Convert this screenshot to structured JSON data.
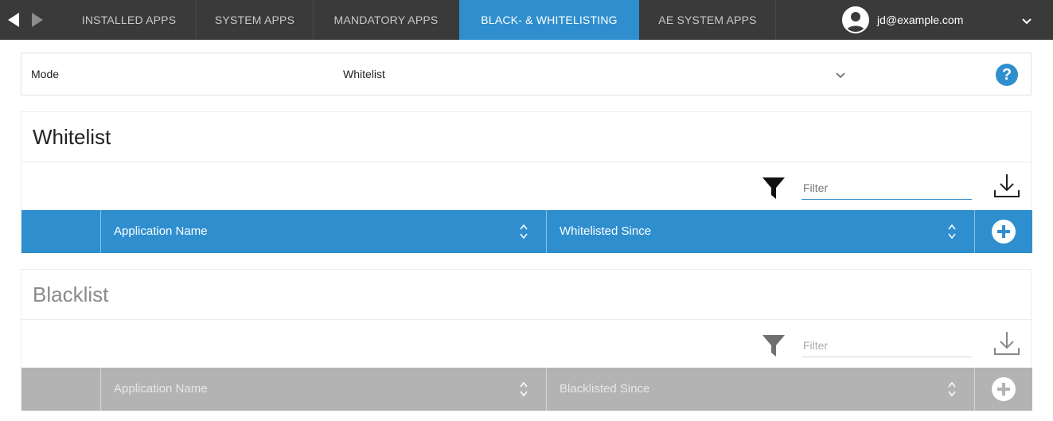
{
  "topbar": {
    "tabs": [
      {
        "label": "INSTALLED APPS",
        "active": false
      },
      {
        "label": "SYSTEM APPS",
        "active": false
      },
      {
        "label": "MANDATORY APPS",
        "active": false
      },
      {
        "label": "BLACK- & WHITELISTING",
        "active": true
      },
      {
        "label": "AE SYSTEM APPS",
        "active": false
      }
    ],
    "user_email": "jd@example.com",
    "icons": {
      "back": "caret-left-icon",
      "forward": "caret-right-icon",
      "avatar": "user-avatar-icon",
      "menu": "chevron-down-icon"
    }
  },
  "mode": {
    "label": "Mode",
    "value": "Whitelist"
  },
  "whitelist": {
    "title": "Whitelist",
    "filter_placeholder": "Filter",
    "columns": [
      "Application Name",
      "Whitelisted Since"
    ],
    "header_color": "#2f8fce"
  },
  "blacklist": {
    "title": "Blacklist",
    "filter_placeholder": "Filter",
    "columns": [
      "Application Name",
      "Blacklisted Since"
    ],
    "header_color": "#b3b3b3"
  },
  "colors": {
    "accent": "#2f8fce",
    "topbar": "#3a3a3a",
    "disabled": "#b3b3b3"
  }
}
